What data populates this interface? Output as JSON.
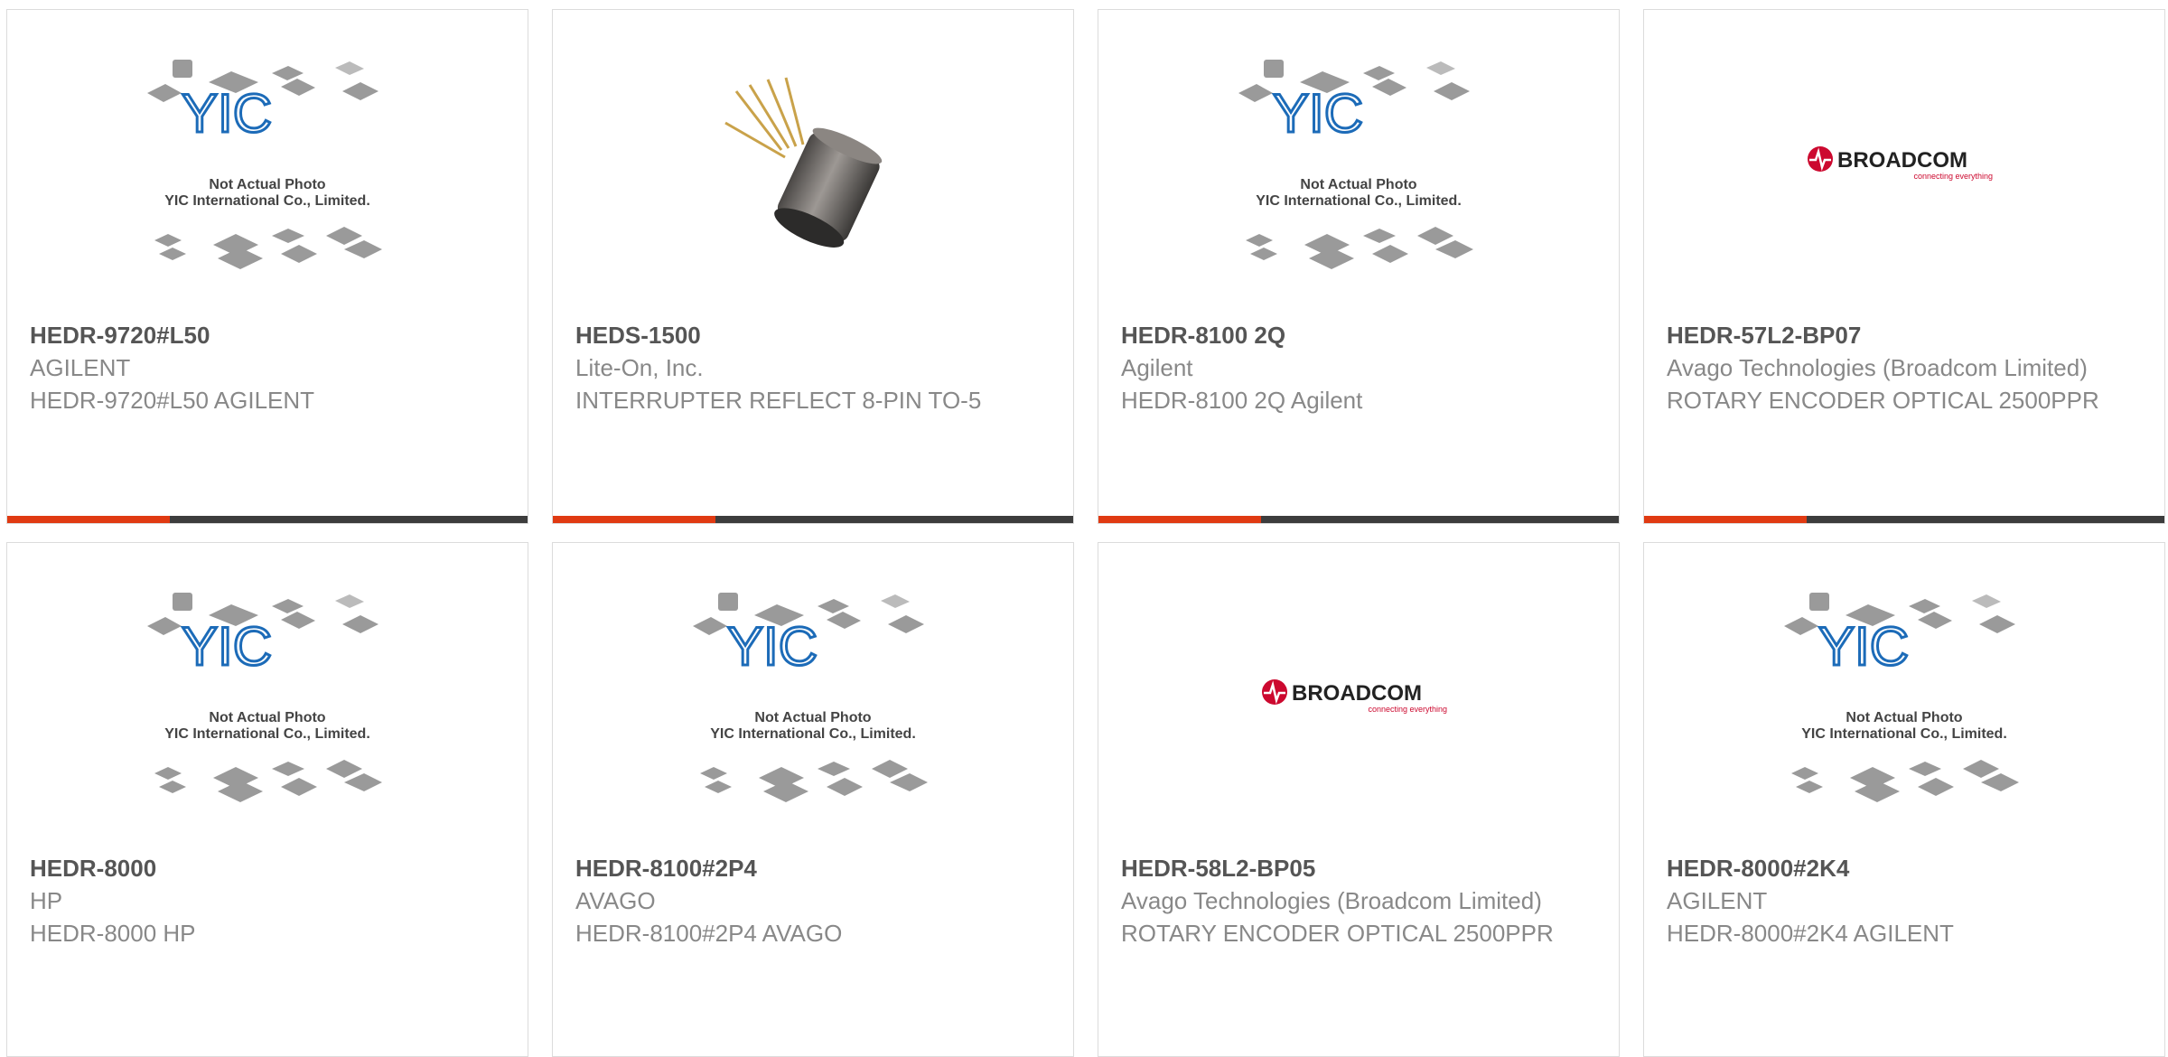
{
  "colors": {
    "accent": "#e03a12",
    "bar_dark": "#3d3d3d",
    "yic_blue": "#1c6bb8",
    "broadcom_red": "#cc092f"
  },
  "placeholder_image": {
    "line1": "Not Actual Photo",
    "line2": "YIC International Co., Limited.",
    "logo": "YIC"
  },
  "broadcom_logo": {
    "name": "BROADCOM",
    "tagline": "connecting everything"
  },
  "products": [
    {
      "part": "HEDR-9720#L50",
      "manufacturer": "AGILENT",
      "description": "HEDR-9720#L50 AGILENT",
      "image": "placeholder"
    },
    {
      "part": "HEDS-1500",
      "manufacturer": "Lite-On, Inc.",
      "description": "INTERRUPTER REFLECT 8-PIN TO-5",
      "image": "component-photo"
    },
    {
      "part": "HEDR-8100 2Q",
      "manufacturer": "Agilent",
      "description": "HEDR-8100 2Q Agilent",
      "image": "placeholder"
    },
    {
      "part": "HEDR-57L2-BP07",
      "manufacturer": "Avago Technologies (Broadcom Limited)",
      "description": "ROTARY ENCODER OPTICAL 2500PPR",
      "image": "broadcom-logo"
    },
    {
      "part": "HEDR-8000",
      "manufacturer": "HP",
      "description": "HEDR-8000 HP",
      "image": "placeholder"
    },
    {
      "part": "HEDR-8100#2P4",
      "manufacturer": "AVAGO",
      "description": "HEDR-8100#2P4 AVAGO",
      "image": "placeholder"
    },
    {
      "part": "HEDR-58L2-BP05",
      "manufacturer": "Avago Technologies (Broadcom Limited)",
      "description": "ROTARY ENCODER OPTICAL 2500PPR",
      "image": "broadcom-logo"
    },
    {
      "part": "HEDR-8000#2K4",
      "manufacturer": "AGILENT",
      "description": "HEDR-8000#2K4 AGILENT",
      "image": "placeholder"
    }
  ]
}
